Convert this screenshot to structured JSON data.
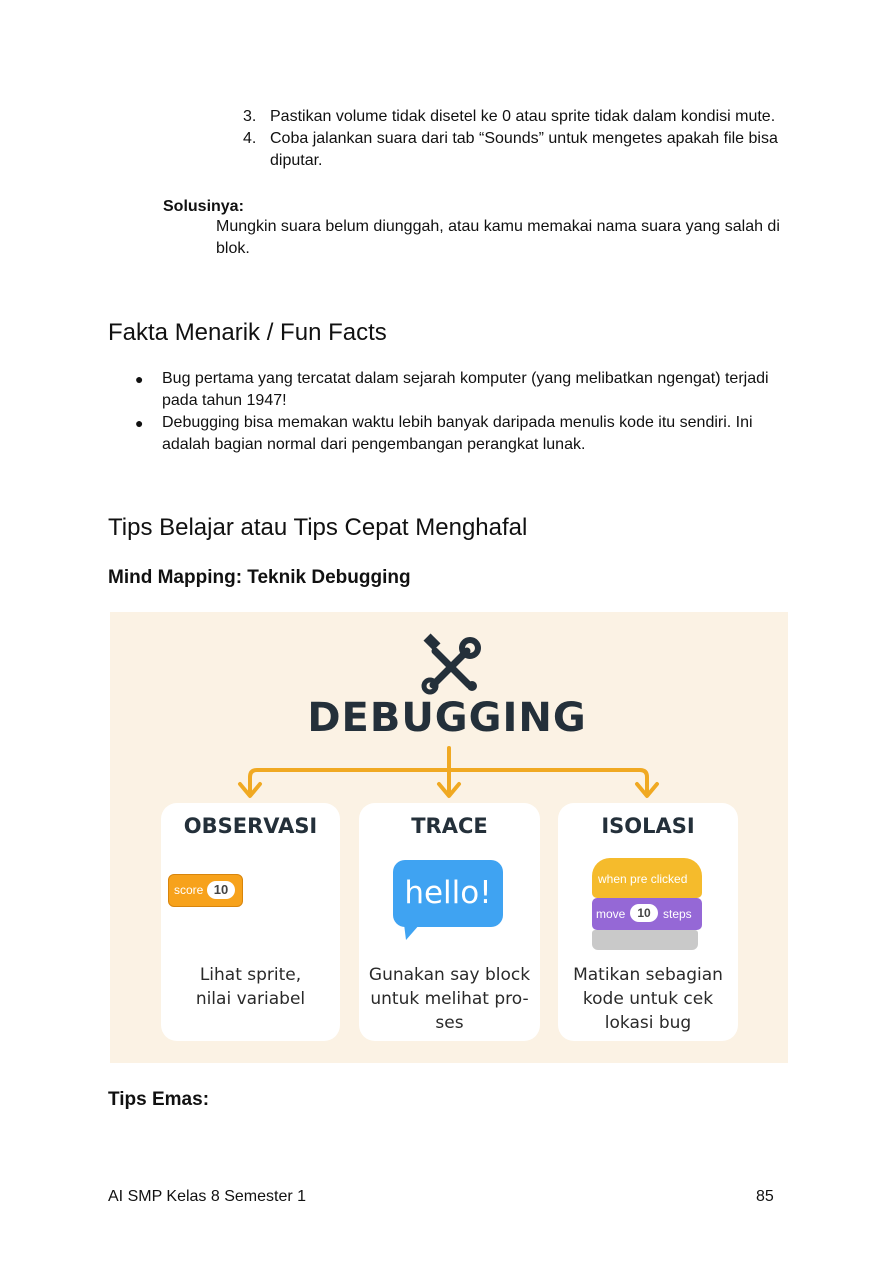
{
  "steps": [
    {
      "num": "3.",
      "text": "Pastikan volume tidak disetel ke 0 atau sprite tidak dalam kondisi mute."
    },
    {
      "num": "4.",
      "text": "Coba jalankan suara dari tab “Sounds” untuk mengetes apakah file bisa diputar."
    }
  ],
  "solution": {
    "heading": "Solusinya:",
    "text": "Mungkin suara belum diunggah, atau kamu memakai nama suara yang salah di blok."
  },
  "fun_facts": {
    "heading": "Fakta Menarik / Fun Facts",
    "items": [
      "Bug pertama yang tercatat dalam sejarah komputer (yang melibatkan ngengat) terjadi pada tahun 1947!",
      "Debugging bisa memakan waktu lebih banyak daripada menulis kode itu sendiri. Ini adalah bagian normal dari pengembangan perangkat lunak."
    ]
  },
  "tips": {
    "heading": "Tips Belajar atau Tips Cepat Menghafal",
    "subheading": "Mind Mapping: Teknik Debugging",
    "gold_tips_heading": "Tips Emas:"
  },
  "mindmap": {
    "title": "DEBUGGING",
    "icon": "tools-icon",
    "colors": {
      "background": "#fbf2e4",
      "arrow": "#f0a922",
      "title": "#24303a"
    },
    "cards": [
      {
        "title": "OBSERVASI",
        "desc_lines": [
          "Lihat sprite,",
          "nilai variabel"
        ]
      },
      {
        "title": "TRACE",
        "desc_lines": [
          "Gunakan say block",
          "untuk melihat pro-",
          "ses"
        ]
      },
      {
        "title": "ISOLASI",
        "desc_lines": [
          "Matikan sebagian",
          "kode untuk cek",
          "lokasi bug"
        ]
      }
    ],
    "score_block": {
      "label": "score",
      "value": "10"
    },
    "speech_bubble": "hello!",
    "code_blocks": {
      "when": "when pre clicked",
      "move_label": "move",
      "move_value": "10",
      "move_unit": "steps"
    }
  },
  "footer": {
    "left": "AI SMP Kelas 8 Semester 1",
    "page": "85"
  }
}
